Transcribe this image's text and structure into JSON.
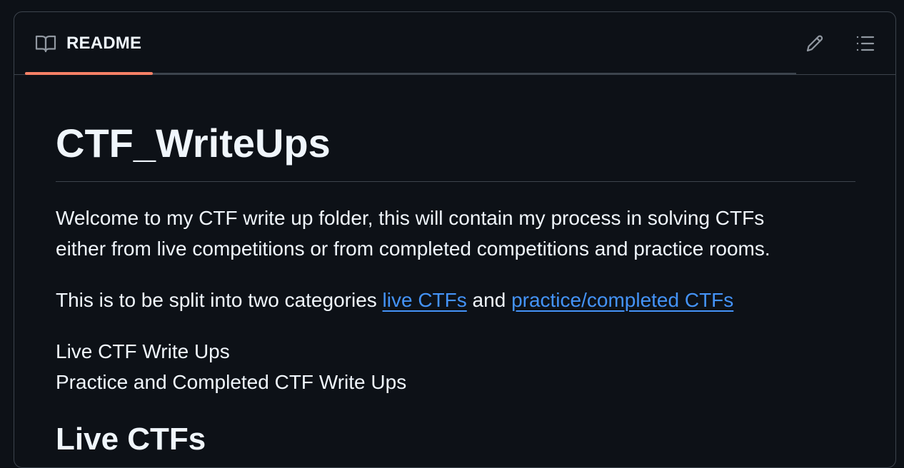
{
  "header": {
    "tab_label": "README",
    "tab_icon": "book-icon",
    "edit_icon": "pencil-icon",
    "toc_icon": "list-unordered-icon",
    "accent_color": "#f78166"
  },
  "content": {
    "title": "CTF_WriteUps",
    "intro_line1": "Welcome to my CTF write up folder, this will contain my process in solving CTFs",
    "intro_line2": "either from live competitions or from completed competitions and practice rooms.",
    "split_text": "This is to be split into two categories ",
    "link_live": "live CTFs",
    "split_and": " and ",
    "link_practice": "practice/completed CTFs",
    "list_line1": "Live CTF Write Ups",
    "list_line2": "Practice and Completed CTF Write Ups",
    "next_heading": "Live CTFs",
    "link_color": "#4493f8"
  }
}
